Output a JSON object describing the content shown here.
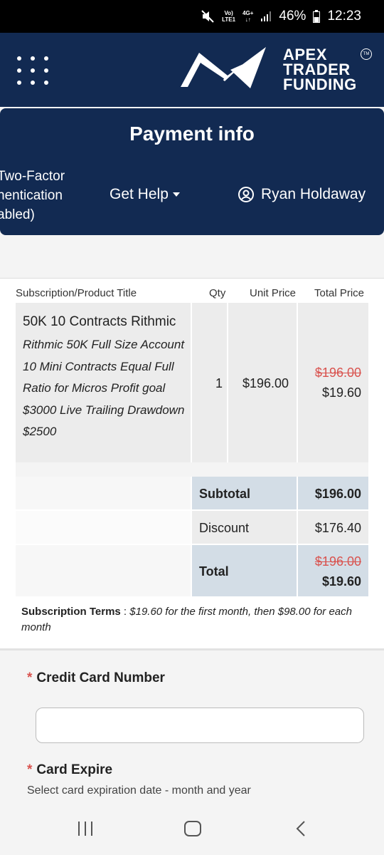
{
  "status_bar": {
    "network_top": "Vo)",
    "network_bottom": "LTE1",
    "signal_type": "4G+",
    "battery": "46%",
    "time": "12:23",
    "icons": [
      "mute-icon",
      "signal-icon",
      "battery-icon"
    ]
  },
  "header": {
    "logo_line1": "APEX",
    "logo_line2": "TRADER",
    "logo_line3": "FUNDING",
    "trademark": "TM",
    "colors": {
      "background": "#122a52",
      "logo": "#ffffff"
    }
  },
  "nav": {
    "title": "Payment info",
    "two_factor": "Two-Factor\nhentication\nabled)",
    "help_label": "Get Help",
    "user_name": "Ryan Holdaway"
  },
  "order_table": {
    "headers": [
      "Subscription/Product Title",
      "Qty",
      "Unit Price",
      "Total Price"
    ],
    "product": {
      "title": "50K 10 Contracts Rithmic",
      "description": "Rithmic 50K Full Size Account 10 Mini Contracts Equal Full Ratio for Micros Profit goal $3000 Live Trailing Drawdown $2500",
      "qty": "1",
      "unit_price": "$196.00",
      "original_total": "$196.00",
      "discounted_total": "$19.60"
    },
    "summary": {
      "subtotal_label": "Subtotal",
      "subtotal_value": "$196.00",
      "discount_label": "Discount",
      "discount_value": "$176.40",
      "total_label": "Total",
      "total_original": "$196.00",
      "total_value": "$19.60"
    },
    "terms_label": "Subscription Terms",
    "terms_separator": " : ",
    "terms_text": "$19.60 for the first month, then $98.00 for each month"
  },
  "form": {
    "required_mark": "*",
    "cc_label": "Credit Card Number",
    "cc_value": "",
    "expire_label": "Card Expire",
    "expire_hint": "Select card expiration date - month and year"
  },
  "colors": {
    "strike": "#d9534f",
    "summary_highlight": "#d3dde6",
    "cell_gray": "#ececec"
  }
}
